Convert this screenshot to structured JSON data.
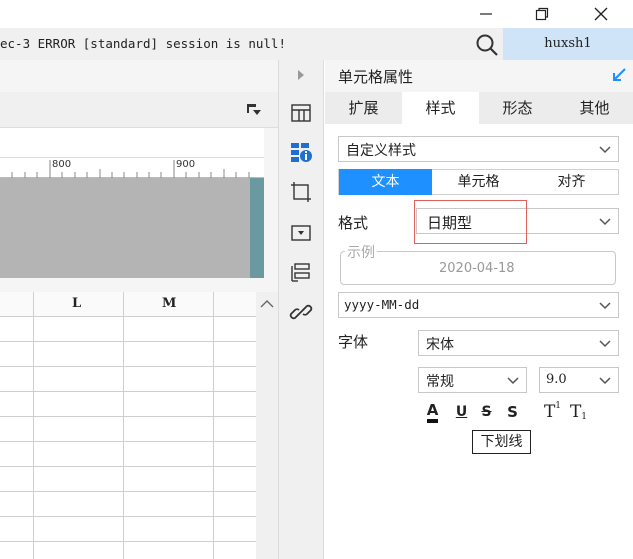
{
  "window": {
    "minimize": "─",
    "maximize": "❐",
    "close": "✕"
  },
  "log": {
    "message": "ec-3 ERROR [standard] session is null!"
  },
  "user": {
    "name": "huxsh1"
  },
  "ruler": {
    "ticks": [
      "800",
      "900"
    ]
  },
  "sheet": {
    "columns": [
      "L",
      "M"
    ]
  },
  "panel": {
    "title": "单元格属性",
    "tabs": [
      "扩展",
      "样式",
      "形态",
      "其他"
    ],
    "active_tab": "样式",
    "style_select": "自定义样式",
    "subtabs": [
      "文本",
      "单元格",
      "对齐"
    ],
    "format_label": "格式",
    "format_value": "日期型",
    "example_legend": "示例",
    "example_value": "2020-04-18",
    "pattern_value": "yyyy-MM-dd",
    "font_label": "字体",
    "font_name": "宋体",
    "font_style": "常规",
    "font_size": "9.0",
    "format_buttons": [
      "A",
      "U",
      "S",
      "S",
      "T",
      "T"
    ],
    "tooltip": "下划线"
  },
  "colors": {
    "accent": "#1e90ff",
    "highlight_box": "#e06060",
    "user_tab": "#cfe4f6",
    "teal": "#6a9aa0"
  }
}
